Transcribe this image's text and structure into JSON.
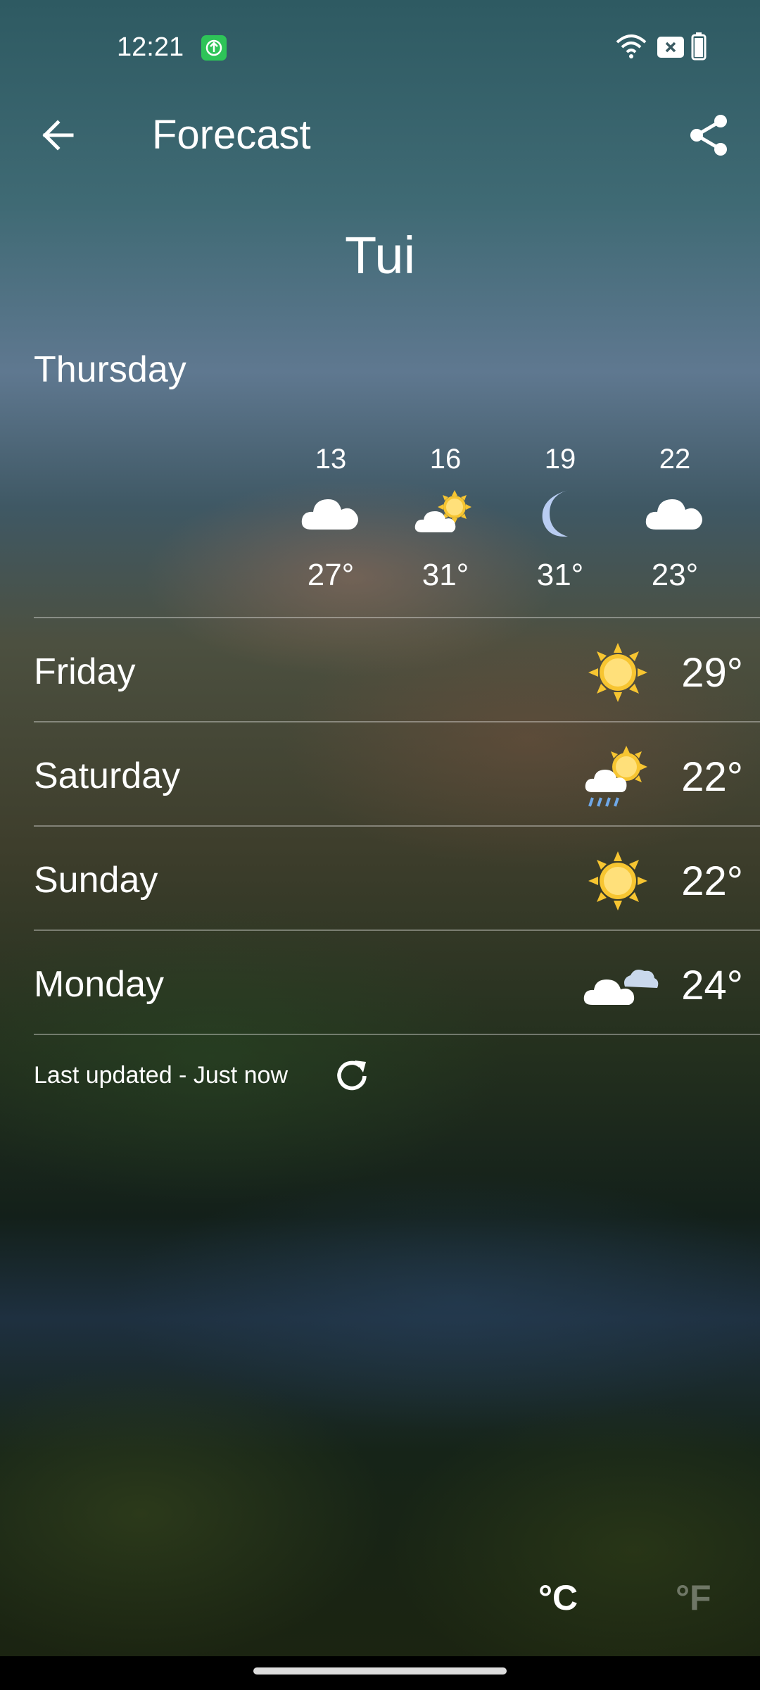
{
  "status": {
    "time": "12:21"
  },
  "header": {
    "title": "Forecast"
  },
  "location": {
    "city": "Tui"
  },
  "today": {
    "day": "Thursday",
    "hours": [
      {
        "hour": "13",
        "icon": "cloud",
        "temp": "27°"
      },
      {
        "hour": "16",
        "icon": "sun-cloud",
        "temp": "31°"
      },
      {
        "hour": "19",
        "icon": "moon",
        "temp": "31°"
      },
      {
        "hour": "22",
        "icon": "cloud",
        "temp": "23°"
      }
    ]
  },
  "forecast": [
    {
      "day": "Friday",
      "icon": "sun",
      "temp": "29°"
    },
    {
      "day": "Saturday",
      "icon": "sun-rain",
      "temp": "22°"
    },
    {
      "day": "Sunday",
      "icon": "sun",
      "temp": "22°"
    },
    {
      "day": "Monday",
      "icon": "clouds",
      "temp": "24°"
    }
  ],
  "footer": {
    "last_updated": "Last updated - Just now"
  },
  "units": {
    "celsius": "°C",
    "fahrenheit": "°F",
    "active": "celsius"
  },
  "colors": {
    "sun": "#f7c531",
    "cloud": "#ffffff",
    "moon": "#b9cdf2"
  }
}
